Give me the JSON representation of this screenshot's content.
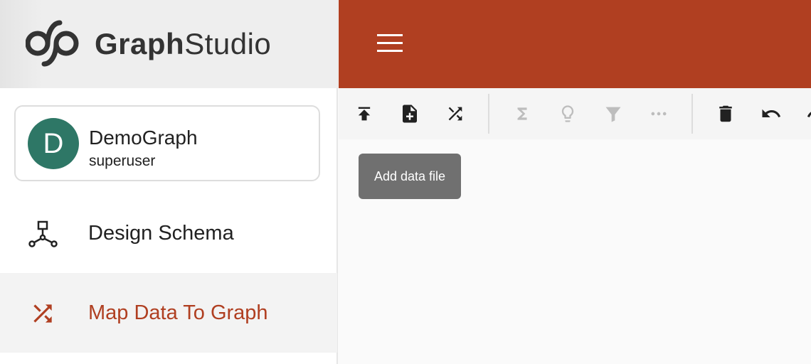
{
  "brand": {
    "name_bold": "Graph",
    "name_light": "Studio"
  },
  "graph": {
    "avatar_letter": "D",
    "name": "DemoGraph",
    "user": "superuser",
    "avatar_color": "#2e7766"
  },
  "nav": [
    {
      "label": "Design Schema",
      "icon": "schema-icon"
    },
    {
      "label": "Map Data To Graph",
      "icon": "shuffle-icon",
      "active": true
    }
  ],
  "colors": {
    "accent": "#b03f21"
  },
  "toolbar": {
    "buttons": [
      "upload-icon",
      "add-file-icon",
      "shuffle-icon",
      "sigma-icon",
      "lightbulb-icon",
      "filter-icon",
      "more-icon",
      "delete-icon",
      "undo-icon",
      "redo-icon"
    ]
  },
  "tooltip": "Add data file"
}
